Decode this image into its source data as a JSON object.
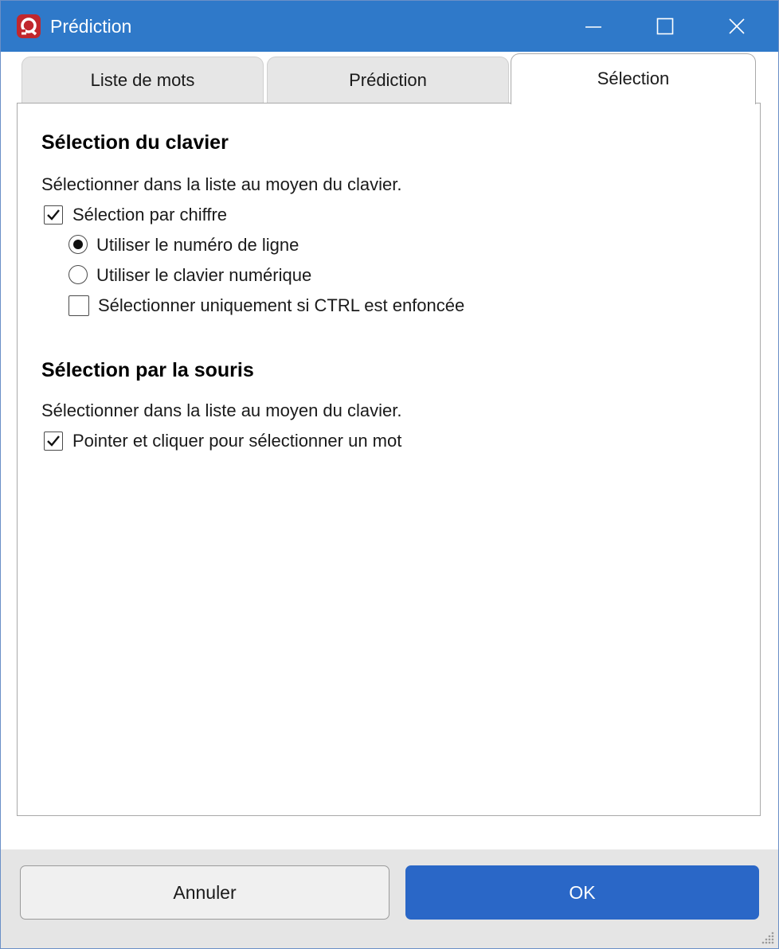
{
  "window": {
    "title": "Prédiction",
    "titlebar_color": "#2f79c9",
    "app_icon": "app-logo-icon",
    "controls": [
      "minimize-icon",
      "maximize-icon",
      "close-icon"
    ]
  },
  "tabs": [
    {
      "label": "Liste de mots",
      "active": false
    },
    {
      "label": "Prédiction",
      "active": false
    },
    {
      "label": "Sélection",
      "active": true
    }
  ],
  "keyboard_section": {
    "title": "Sélection du clavier",
    "description": "Sélectionner dans la liste au moyen du clavier.",
    "select_by_number": {
      "label": "Sélection par chiffre",
      "checked": true
    },
    "use_line_number": {
      "label": "Utiliser le numéro de ligne",
      "selected": true
    },
    "use_numeric_keypad": {
      "label": "Utiliser le clavier numérique",
      "selected": false
    },
    "only_with_ctrl": {
      "label": "Sélectionner uniquement si CTRL est enfoncée",
      "checked": false
    }
  },
  "mouse_section": {
    "title": "Sélection par la souris",
    "description": "Sélectionner dans la liste au moyen du clavier.",
    "point_and_click": {
      "label": "Pointer et cliquer pour sélectionner un mot",
      "checked": true
    }
  },
  "footer": {
    "cancel_label": "Annuler",
    "ok_label": "OK",
    "ok_color": "#2a67c7"
  }
}
